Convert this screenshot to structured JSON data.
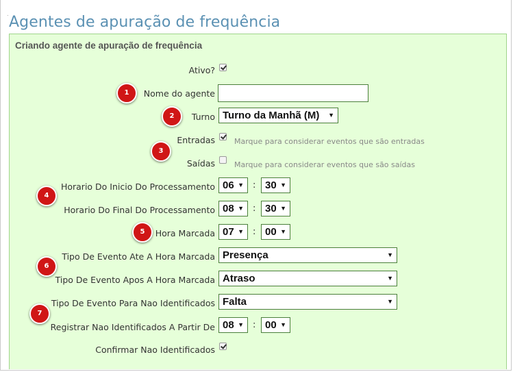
{
  "page_title": "Agentes de apuração de frequência",
  "panel_title": "Criando agente de apuração de frequência",
  "fields": {
    "ativo": {
      "label": "Ativo?",
      "checked": true
    },
    "nome": {
      "label": "Nome do agente",
      "value": ""
    },
    "turno": {
      "label": "Turno",
      "value": "Turno da Manhã (M)"
    },
    "entradas": {
      "label": "Entradas",
      "checked": true,
      "hint": "Marque para considerar eventos que são entradas"
    },
    "saidas": {
      "label": "Saídas",
      "checked": false,
      "hint": "Marque para considerar eventos que são saídas"
    },
    "inicio": {
      "label": "Horario Do Inicio Do Processamento",
      "hour": "06",
      "minute": "30"
    },
    "final": {
      "label": "Horario Do Final Do Processamento",
      "hour": "08",
      "minute": "30"
    },
    "hora_marcada": {
      "label": "Hora Marcada",
      "hour": "07",
      "minute": "00"
    },
    "ate": {
      "label": "Tipo De Evento Ate A Hora Marcada",
      "value": "Presença"
    },
    "apos": {
      "label": "Tipo De Evento Apos A Hora Marcada",
      "value": "Atraso"
    },
    "nao_ident": {
      "label": "Tipo De Evento Para Nao Identificados",
      "value": "Falta"
    },
    "registrar": {
      "label": "Registrar Nao Identificados A Partir De",
      "hour": "08",
      "minute": "00"
    },
    "confirmar": {
      "label": "Confirmar Nao Identificados",
      "checked": true
    }
  },
  "time_separator": ":",
  "dropdown_arrow": "▼",
  "badges": [
    "1",
    "2",
    "3",
    "4",
    "5",
    "6",
    "7"
  ],
  "colors": {
    "title": "#5b91b3",
    "panel_bg": "#e6ffd9",
    "badge": "#d01616"
  }
}
